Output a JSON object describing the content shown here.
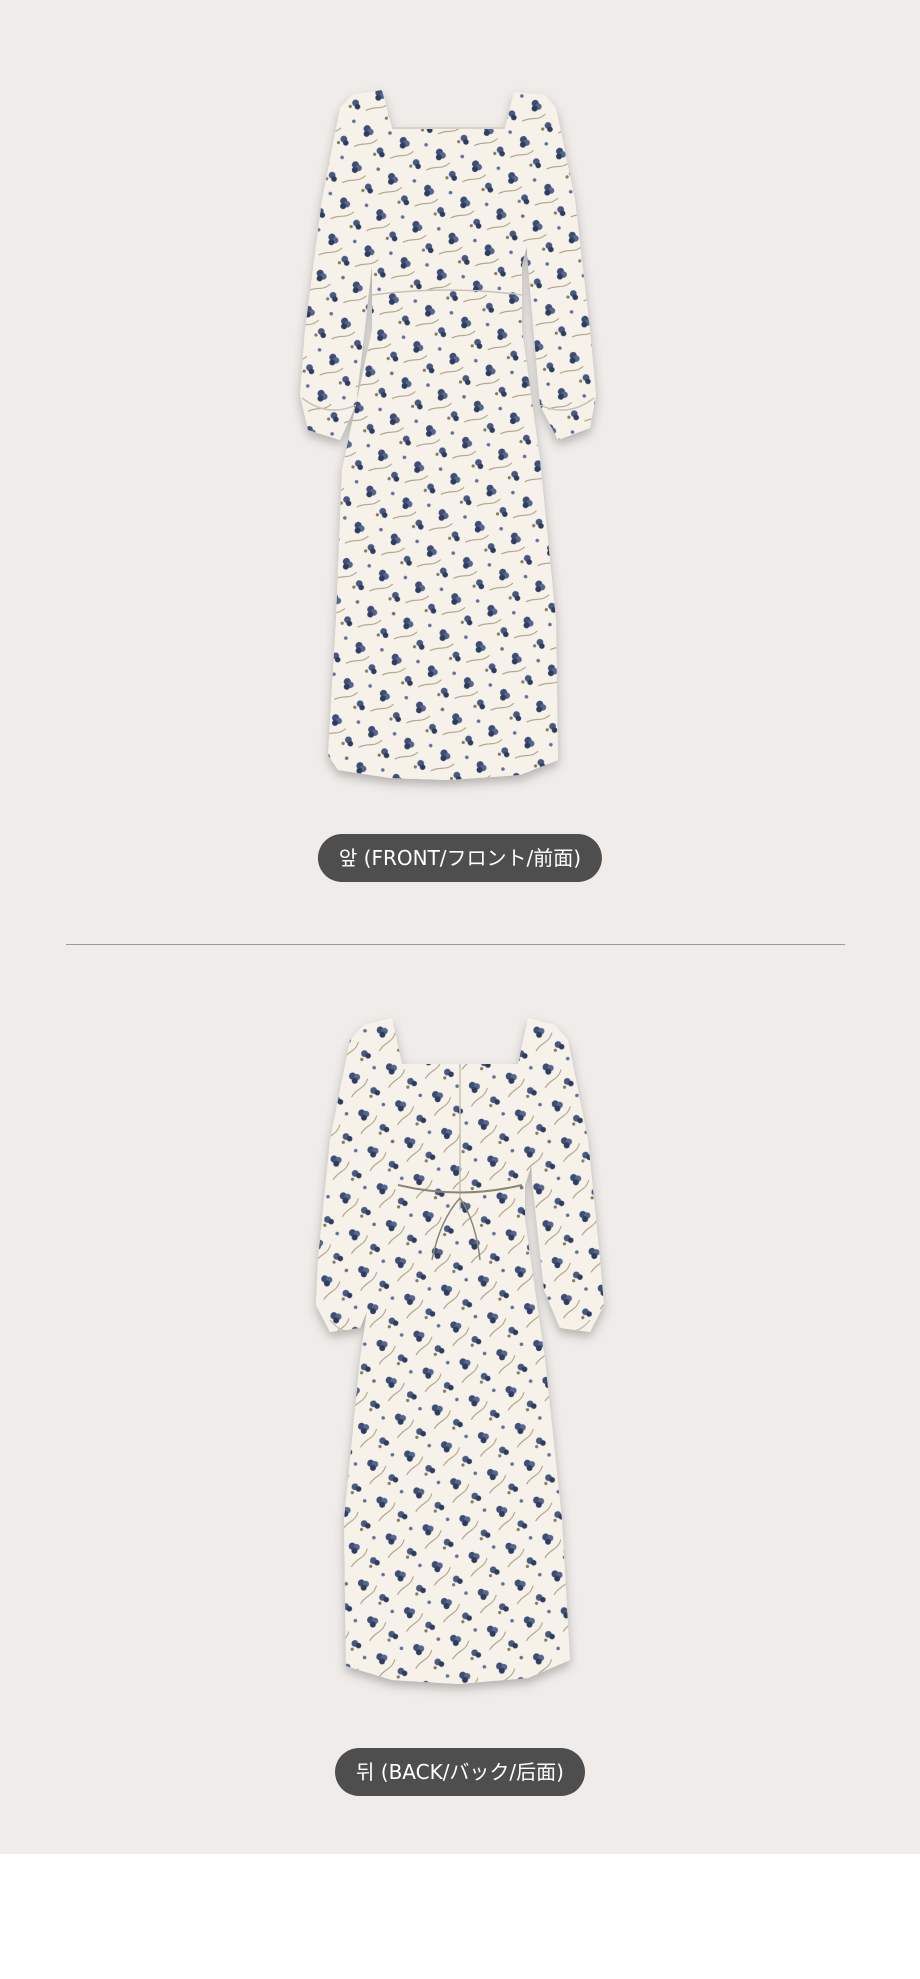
{
  "colors": {
    "page_background": "#efece9",
    "label_background": "#4e4e4e",
    "label_text": "#ffffff",
    "divider": "#9d9a97",
    "fabric": "#f6f2ea",
    "print_flower": "#3c4d75"
  },
  "front": {
    "image": "floral-long-sleeve-dress-front",
    "label": "앞 (FRONT/フロント/前面)"
  },
  "back": {
    "image": "floral-long-sleeve-dress-back",
    "label": "뒤 (BACK/バック/后面)"
  }
}
